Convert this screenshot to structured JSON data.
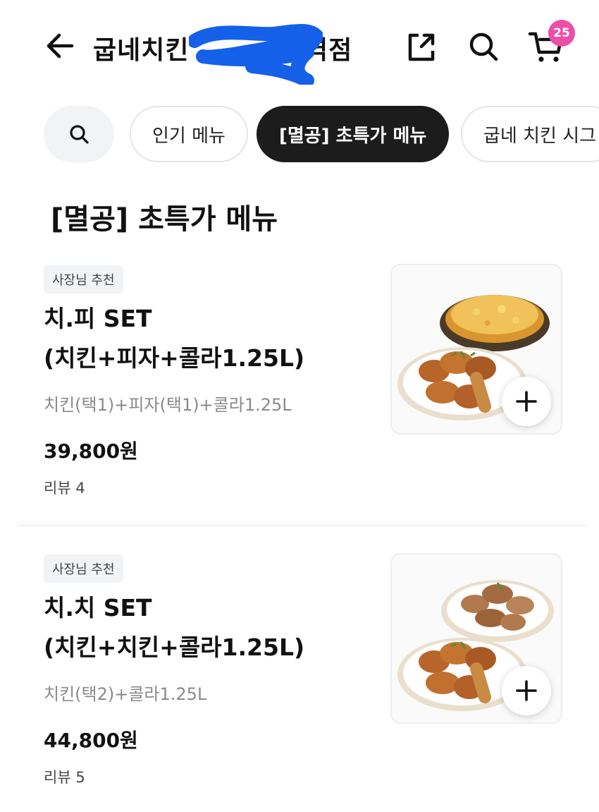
{
  "header": {
    "title": "굽네치킨 ",
    "title_suffix": "역점",
    "cart_count": "25",
    "accent_color": "#ec4fa8",
    "icons": [
      "back-arrow-icon",
      "share-icon",
      "search-icon",
      "cart-icon"
    ]
  },
  "tabs": [
    {
      "label": "인기 메뉴",
      "active": false
    },
    {
      "label": "[멸공] 초특가 메뉴",
      "active": true
    },
    {
      "label": "굽네 치킨 시그",
      "active": false
    }
  ],
  "section": {
    "title": "[멸공] 초특가 메뉴"
  },
  "items": [
    {
      "badge": "사장님 추천",
      "name_line1": "치.피 SET",
      "name_line2": "(치킨+피자+콜라1.25L)",
      "description": "치킨(택1)+피자(택1)+콜라1.25L",
      "price": "39,800원",
      "review": "리뷰 4",
      "image": "chicken-and-pizza-photo"
    },
    {
      "badge": "사장님 추천",
      "name_line1": "치.치 SET",
      "name_line2": "(치킨+치킨+콜라1.25L)",
      "description": "치킨(택2)+콜라1.25L",
      "price": "44,800원",
      "review": "리뷰 5",
      "image": "two-chicken-plates-photo"
    }
  ]
}
